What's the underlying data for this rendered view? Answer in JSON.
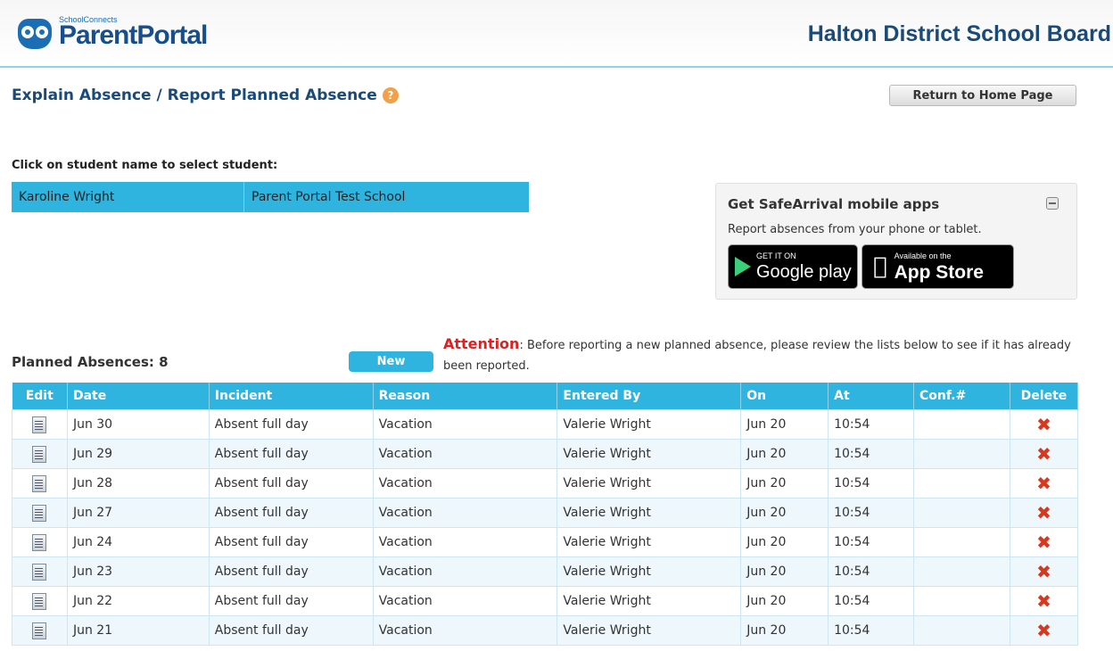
{
  "header": {
    "logo_small": "SchoolConnects",
    "logo_big": "ParentPortal",
    "board_name": "Halton District School Board"
  },
  "page": {
    "title": "Explain Absence / Report Planned Absence",
    "help_icon": "?",
    "return_label": "Return to Home Page"
  },
  "student_select": {
    "label": "Click on student name to select student:",
    "student_name": "Karoline Wright",
    "school": "Parent Portal Test School"
  },
  "apps": {
    "title": "Get SafeArrival mobile apps",
    "subtitle": "Report absences from your phone or tablet.",
    "google_small": "GET IT ON",
    "google_big": "Google play",
    "apple_small": "Available on the",
    "apple_big": "App Store"
  },
  "planned": {
    "count_label": "Planned Absences: 8",
    "new_label": "New",
    "attention_word": "Attention",
    "attention_text": ": Before reporting a new planned absence, please review the lists below to see if it has already been reported."
  },
  "table": {
    "headers": [
      "Edit",
      "Date",
      "Incident",
      "Reason",
      "Entered By",
      "On",
      "At",
      "Conf.#",
      "Delete"
    ],
    "rows": [
      {
        "date": "Jun 30",
        "incident": "Absent full day",
        "reason": "Vacation",
        "entered_by": "Valerie Wright",
        "on": "Jun 20",
        "at": "10:54",
        "conf": ""
      },
      {
        "date": "Jun 29",
        "incident": "Absent full day",
        "reason": "Vacation",
        "entered_by": "Valerie Wright",
        "on": "Jun 20",
        "at": "10:54",
        "conf": ""
      },
      {
        "date": "Jun 28",
        "incident": "Absent full day",
        "reason": "Vacation",
        "entered_by": "Valerie Wright",
        "on": "Jun 20",
        "at": "10:54",
        "conf": ""
      },
      {
        "date": "Jun 27",
        "incident": "Absent full day",
        "reason": "Vacation",
        "entered_by": "Valerie Wright",
        "on": "Jun 20",
        "at": "10:54",
        "conf": ""
      },
      {
        "date": "Jun 24",
        "incident": "Absent full day",
        "reason": "Vacation",
        "entered_by": "Valerie Wright",
        "on": "Jun 20",
        "at": "10:54",
        "conf": ""
      },
      {
        "date": "Jun 23",
        "incident": "Absent full day",
        "reason": "Vacation",
        "entered_by": "Valerie Wright",
        "on": "Jun 20",
        "at": "10:54",
        "conf": ""
      },
      {
        "date": "Jun 22",
        "incident": "Absent full day",
        "reason": "Vacation",
        "entered_by": "Valerie Wright",
        "on": "Jun 20",
        "at": "10:54",
        "conf": ""
      },
      {
        "date": "Jun 21",
        "incident": "Absent full day",
        "reason": "Vacation",
        "entered_by": "Valerie Wright",
        "on": "Jun 20",
        "at": "10:54",
        "conf": ""
      }
    ]
  },
  "icons": {
    "edit": "edit-note-icon",
    "delete": "delete-x-icon",
    "help": "help-icon",
    "collapse": "collapse-icon"
  },
  "colors": {
    "accent": "#2fb4e0",
    "title": "#1a4a78",
    "attention": "#e02020",
    "delete": "#d9381e"
  }
}
